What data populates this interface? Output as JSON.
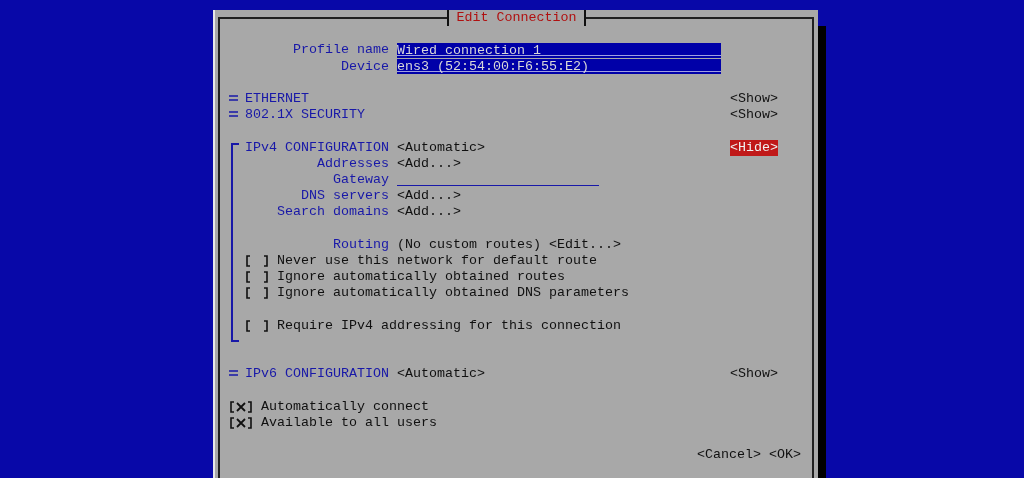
{
  "dialog": {
    "title": "Edit Connection"
  },
  "fields": [
    {
      "label": "Profile name",
      "value": "Wired connection 1"
    },
    {
      "label": "Device",
      "value": "ens3 (52:54:00:F6:55:E2)"
    }
  ],
  "sections": [
    {
      "title": "ETHERNET",
      "expanded": false,
      "toggle": {
        "label": "<Show>",
        "selected": false
      }
    },
    {
      "title": "802.1X SECURITY",
      "expanded": false,
      "toggle": {
        "label": "<Show>",
        "selected": false
      }
    },
    {
      "title": "IPv4 CONFIGURATION",
      "mode": "<Automatic>",
      "expanded": true,
      "toggle": {
        "label": "<Hide>",
        "selected": true
      },
      "rows": [
        {
          "kind": "button",
          "label": "Addresses",
          "value": "<Add...>"
        },
        {
          "kind": "input",
          "label": "Gateway"
        },
        {
          "kind": "button",
          "label": "DNS servers",
          "value": "<Add...>"
        },
        {
          "kind": "button",
          "label": "Search domains",
          "value": "<Add...>"
        },
        {
          "kind": "blank"
        },
        {
          "kind": "routing",
          "label": "Routing",
          "value": "(No custom routes)",
          "button": "<Edit...>"
        },
        {
          "kind": "checkbox",
          "label": "Never use this network for default route",
          "checked": false
        },
        {
          "kind": "checkbox",
          "label": "Ignore automatically obtained routes",
          "checked": false
        },
        {
          "kind": "checkbox",
          "label": "Ignore automatically obtained DNS parameters",
          "checked": false
        },
        {
          "kind": "blank"
        },
        {
          "kind": "checkbox",
          "label": "Require IPv4 addressing for this connection",
          "checked": false
        }
      ]
    },
    {
      "title": "IPv6 CONFIGURATION",
      "mode": "<Automatic>",
      "expanded": false,
      "toggle": {
        "label": "<Show>",
        "selected": false
      }
    }
  ],
  "options": [
    {
      "label": "Automatically connect",
      "checked": true
    },
    {
      "label": "Available to all users",
      "checked": true
    }
  ],
  "buttons": [
    {
      "label": "<Cancel>",
      "selected": false
    },
    {
      "label": "<OK>",
      "selected": false
    }
  ]
}
